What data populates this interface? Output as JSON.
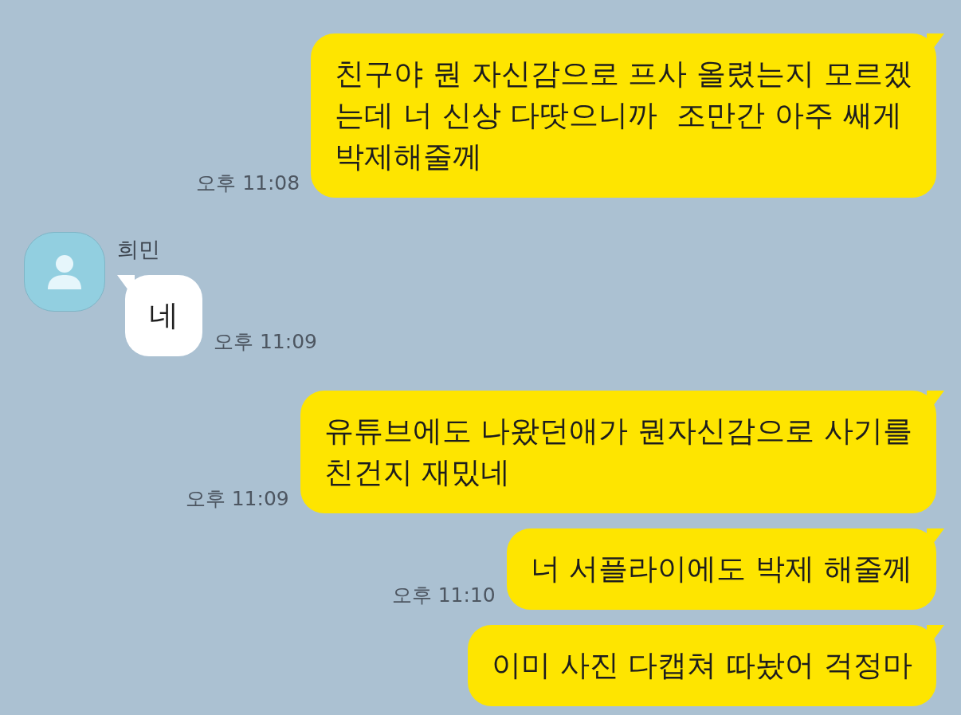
{
  "messages": [
    {
      "kind": "sent",
      "text": "친구야 뭔 자신감으로 프사 올렸는지 모르겠\n는데 너 신상 다땃으니까  조만간 아주 쌔게\n박제해줄께",
      "time": "오후 11:08"
    },
    {
      "kind": "received",
      "sender": "희민",
      "text": "네",
      "time": "오후 11:09"
    },
    {
      "kind": "sent",
      "text": "유튜브에도 나왔던애가 뭔자신감으로 사기를\n친건지 재밌네",
      "time": "오후 11:09"
    },
    {
      "kind": "sent",
      "text": "너 서플라이에도 박제 해줄께",
      "time": "오후 11:10"
    },
    {
      "kind": "sent",
      "text": "이미 사진 다캡쳐 따놨어 걱정마"
    }
  ]
}
